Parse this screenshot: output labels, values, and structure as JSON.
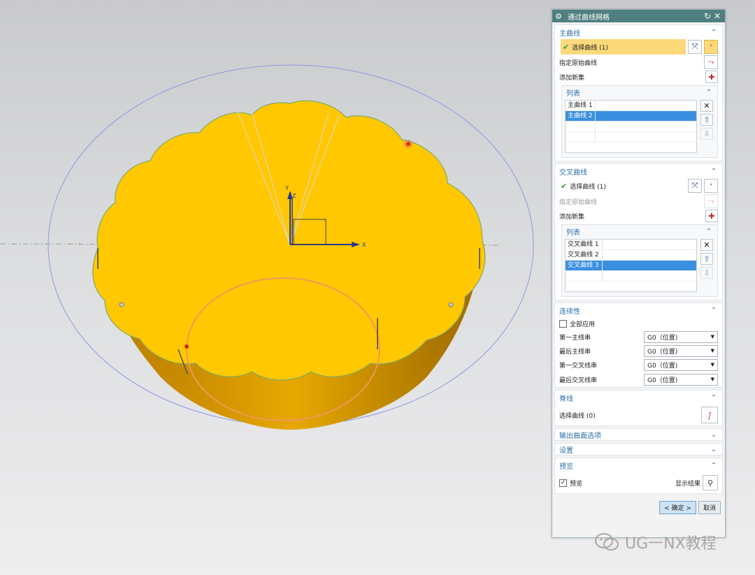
{
  "dialog": {
    "title": "通过曲线网格",
    "reset_icon": "reset-icon",
    "close_icon": "close-icon",
    "primary": {
      "label": "主曲线",
      "select_label": "选择曲线 (1)",
      "specify_origin_label": "指定原始曲线",
      "add_set_label": "添加新集",
      "list_label": "列表",
      "items": [
        "主曲线 1",
        "主曲线 2"
      ],
      "active_index": 1
    },
    "cross": {
      "label": "交叉曲线",
      "select_label": "选择曲线 (1)",
      "specify_origin_label": "指定原始曲线",
      "add_set_label": "添加新集",
      "list_label": "列表",
      "items": [
        "交叉曲线 1",
        "交叉曲线 2",
        "交叉曲线 3"
      ],
      "active_index": 2
    },
    "continuity": {
      "label": "连续性",
      "apply_all_label": "全部应用",
      "apply_all_checked": false,
      "rows": [
        {
          "label": "第一主线串",
          "value": "G0（位置)"
        },
        {
          "label": "最后主线串",
          "value": "G0（位置)"
        },
        {
          "label": "第一交叉线串",
          "value": "G0（位置)"
        },
        {
          "label": "最后交叉线串",
          "value": "G0（位置)"
        }
      ]
    },
    "spine": {
      "label": "脊线",
      "select_label": "选择曲线 (0)"
    },
    "output_options_label": "输出曲面选项",
    "settings_label": "设置",
    "preview": {
      "label": "预览",
      "preview_label": "预览",
      "preview_checked": true,
      "show_result_label": "显示结果"
    },
    "ok_label": "< 确定 >",
    "cancel_label": "取消"
  },
  "viewport": {
    "axis_x_label": "X",
    "axis_y_label": "Y",
    "axis_z_label": "Z",
    "surface_color": "#ffc800",
    "side_color": "#c98a00"
  },
  "watermark": {
    "text": "UG一NX教程"
  }
}
